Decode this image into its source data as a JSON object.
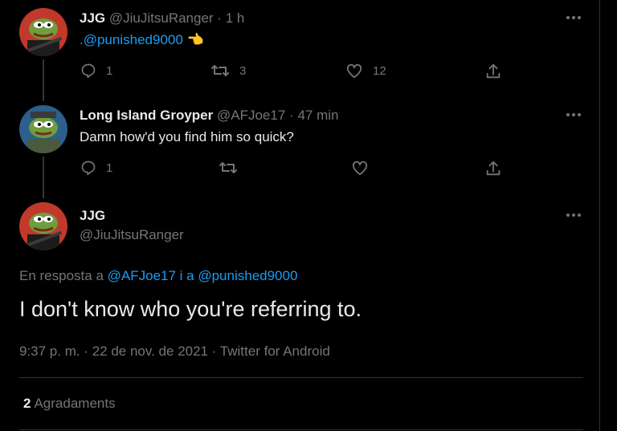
{
  "colors": {
    "background": "#000000",
    "text": "#e7e9ea",
    "secondary": "#71767b",
    "link": "#1d9bf0",
    "border": "#2f3336"
  },
  "tweets": [
    {
      "display_name": "JJG",
      "handle": "@JiuJitsuRanger",
      "separator": "·",
      "time": "1 h",
      "mention": ".@punished9000",
      "emoji": "👈",
      "avatar_icon": "pepe-avatar-red",
      "replies": "1",
      "retweets": "3",
      "likes": "12"
    },
    {
      "display_name": "Long Island Groyper",
      "handle": "@AFJoe17",
      "separator": "·",
      "time": "47 min",
      "text": "Damn how'd you find him so quick?",
      "avatar_icon": "pepe-avatar-blue",
      "replies": "1"
    }
  ],
  "focus": {
    "display_name": "JJG",
    "handle": "@JiuJitsuRanger",
    "reply_prefix": "En resposta a",
    "reply_mentions": "@AFJoe17 i a @punished9000",
    "text": "I don't know who you're referring to.",
    "meta": "9:37 p. m. · 22 de nov. de 2021 · Twitter for Android",
    "like_count": "2",
    "like_label": "Agradaments",
    "avatar_icon": "pepe-avatar-red"
  }
}
